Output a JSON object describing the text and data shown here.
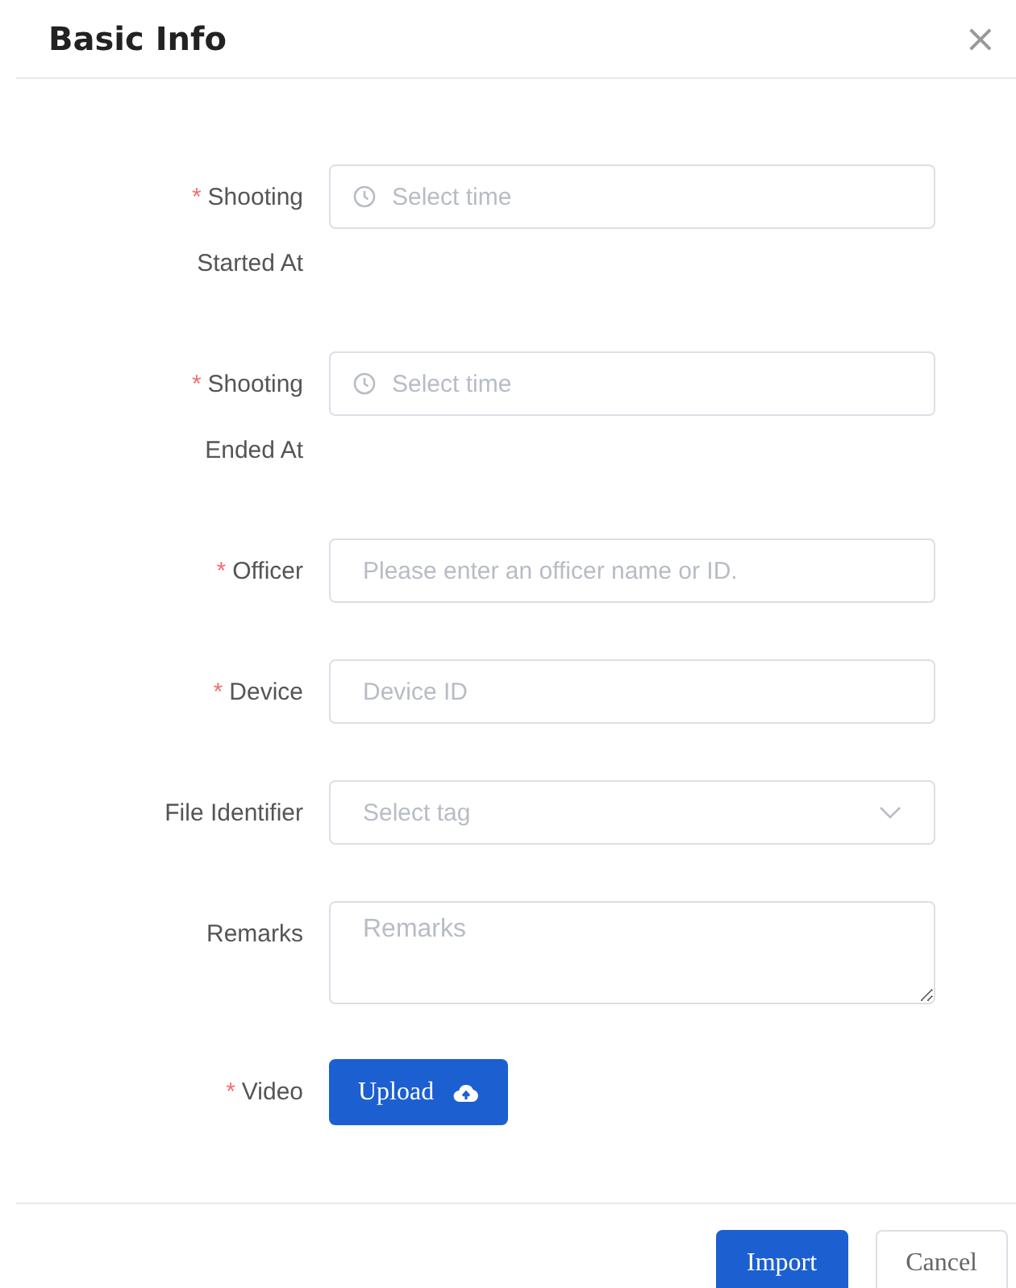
{
  "dialog": {
    "title": "Basic Info",
    "close": "×"
  },
  "fields": [
    {
      "kind": "time",
      "required_mark": "*",
      "label": "Shooting Started At",
      "placeholder": "Select time"
    },
    {
      "kind": "time",
      "required_mark": "*",
      "label": "Shooting Ended At",
      "placeholder": "Select time"
    },
    {
      "kind": "text",
      "required_mark": "*",
      "label": "Officer",
      "placeholder": "Please enter an officer name or ID."
    },
    {
      "kind": "text",
      "required_mark": "*",
      "label": "Device",
      "placeholder": "Device ID"
    },
    {
      "kind": "select",
      "label": "File Identifier",
      "placeholder": "Select tag"
    },
    {
      "kind": "textarea",
      "label": "Remarks",
      "placeholder": "Remarks"
    },
    {
      "kind": "upload",
      "required_mark": "*",
      "label": "Video",
      "button": "Upload"
    }
  ],
  "buttons": [
    {
      "label": "Import",
      "kind": "primary"
    },
    {
      "label": "Cancel",
      "kind": "default"
    }
  ]
}
